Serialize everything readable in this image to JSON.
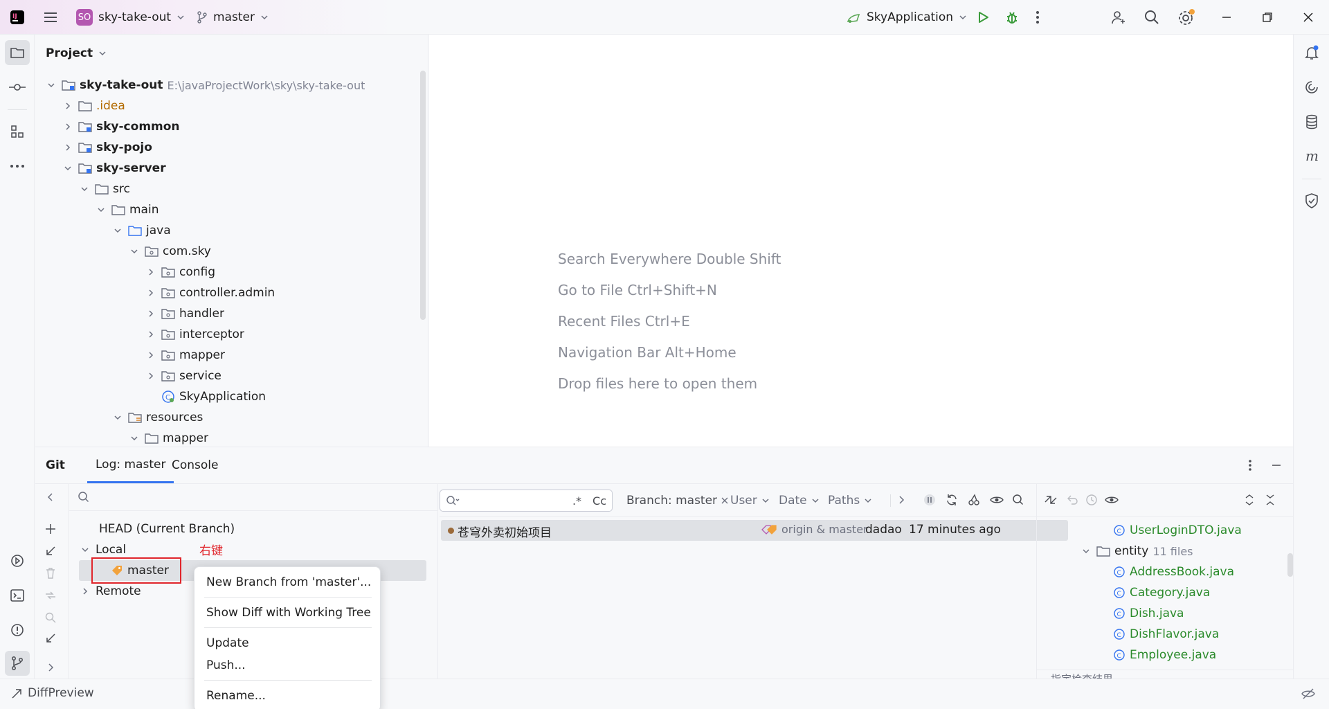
{
  "titlebar": {
    "project_badge": "SO",
    "project_name": "sky-take-out",
    "branch": "master",
    "run_config": "SkyApplication"
  },
  "project_panel": {
    "title": "Project",
    "tree": [
      {
        "label": "sky-take-out",
        "path": "E:\\javaProjectWork\\sky\\sky-take-out"
      },
      {
        "label": ".idea"
      },
      {
        "label": "sky-common"
      },
      {
        "label": "sky-pojo"
      },
      {
        "label": "sky-server"
      },
      {
        "label": "src"
      },
      {
        "label": "main"
      },
      {
        "label": "java"
      },
      {
        "label": "com.sky"
      },
      {
        "label": "config"
      },
      {
        "label": "controller.admin"
      },
      {
        "label": "handler"
      },
      {
        "label": "interceptor"
      },
      {
        "label": "mapper"
      },
      {
        "label": "service"
      },
      {
        "label": "SkyApplication"
      },
      {
        "label": "resources"
      },
      {
        "label": "mapper"
      }
    ]
  },
  "editor": {
    "hints": [
      "Search Everywhere Double Shift",
      "Go to File Ctrl+Shift+N",
      "Recent Files Ctrl+E",
      "Navigation Bar Alt+Home",
      "Drop files here to open them"
    ]
  },
  "git": {
    "tabs": [
      "Git",
      "Log: master",
      "Console"
    ],
    "branches": {
      "head": "HEAD (Current Branch)",
      "local": "Local",
      "local_branch": "master",
      "remote": "Remote",
      "annotation": "右键"
    },
    "log_filters": {
      "regex": ".*",
      "case": "Cc",
      "branch": "Branch: master",
      "user": "User",
      "date": "Date",
      "paths": "Paths"
    },
    "commits": [
      {
        "message": "苍穹外卖初始项目",
        "refs": "origin & master",
        "author": "dadao",
        "time": "17 minutes ago"
      }
    ],
    "changed_files": {
      "top_file": "UserLoginDTO.java",
      "folder": "entity",
      "folder_count": "11 files",
      "files": [
        "AddressBook.java",
        "Category.java",
        "Dish.java",
        "DishFlavor.java",
        "Employee.java"
      ],
      "cut_off": "指定检查结果"
    }
  },
  "context_menu": {
    "items": [
      "New Branch from 'master'...",
      "Show Diff with Working Tree",
      "Update",
      "Push...",
      "Rename..."
    ]
  },
  "statusbar": {
    "label": "DiffPreview"
  },
  "colors": {
    "accent_blue": "#3574f0",
    "highlight_red": "#e0252b",
    "file_green": "#2a8a2a",
    "project_badge": "#b357b0"
  }
}
